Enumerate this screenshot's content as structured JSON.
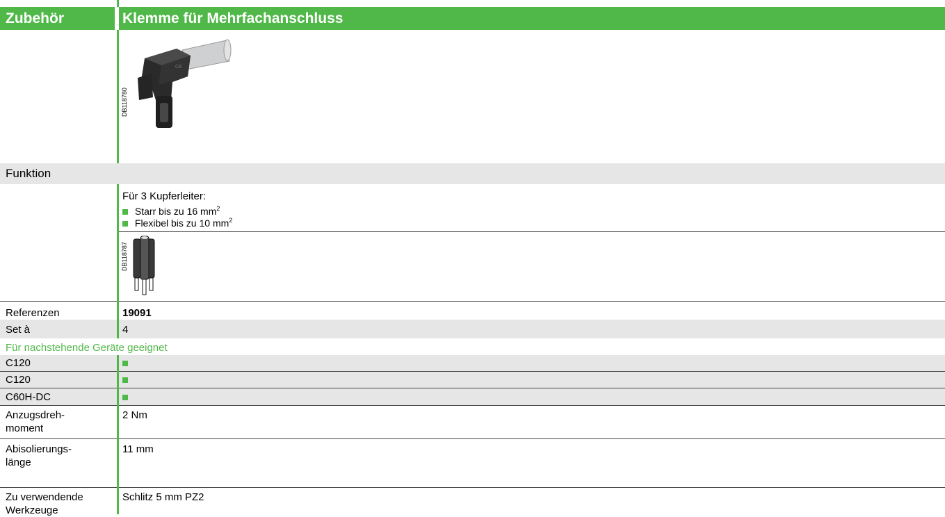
{
  "header": {
    "section": "Zubehör",
    "title": "Klemme für Mehrfachanschluss"
  },
  "image_codes": {
    "product": "DB118780",
    "conductor": "DB118787"
  },
  "function": {
    "heading": "Funktion",
    "intro": "Für 3 Kupferleiter:",
    "bullets": [
      {
        "text": "Starr bis zu 16 mm",
        "sup": "2"
      },
      {
        "text": "Flexibel bis zu 10 mm",
        "sup": "2"
      }
    ]
  },
  "references": {
    "label": "Referenzen",
    "value": "19091"
  },
  "set": {
    "label": "Set à",
    "value": "4"
  },
  "compatible": {
    "heading": "Für nachstehende Geräte geeignet",
    "devices": [
      {
        "name": "C120"
      },
      {
        "name": "C120"
      },
      {
        "name": "C60H-DC"
      }
    ]
  },
  "specs": {
    "torque": {
      "label_line1": "Anzugsdreh-",
      "label_line2": "moment",
      "value": "2 Nm"
    },
    "strip": {
      "label_line1": "Abisolierungs-",
      "label_line2": "länge",
      "value": "11 mm"
    },
    "tools": {
      "label_line1": "Zu verwendende",
      "label_line2": "Werkzeuge",
      "value": "Schlitz 5 mm PZ2"
    }
  },
  "colors": {
    "accent": "#4fb848",
    "grey_band": "#e6e6e6"
  }
}
